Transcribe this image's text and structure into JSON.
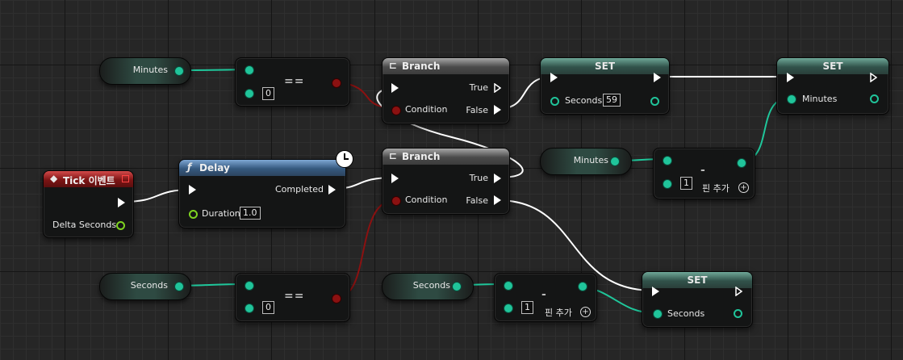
{
  "nodes": {
    "minutes_get_top": {
      "label": "Minutes"
    },
    "eq_top": {
      "op": "==",
      "input_value": "0"
    },
    "branch_top": {
      "title": "Branch",
      "true_label": "True",
      "false_label": "False",
      "condition_label": "Condition"
    },
    "set_seconds_59": {
      "title": "SET",
      "var_label": "Seconds",
      "value": "59"
    },
    "set_minutes": {
      "title": "SET",
      "var_label": "Minutes"
    },
    "tick_event": {
      "title": "Tick 이벤트",
      "output_label": "Delta Seconds"
    },
    "delay": {
      "title": "Delay",
      "completed_label": "Completed",
      "duration_label": "Duration",
      "duration_value": "1.0"
    },
    "branch_mid": {
      "title": "Branch",
      "true_label": "True",
      "false_label": "False",
      "condition_label": "Condition"
    },
    "minutes_get_mid": {
      "label": "Minutes"
    },
    "subtract_minutes": {
      "op": "-",
      "input_value": "1",
      "add_pin_label": "핀 추가"
    },
    "seconds_get_left": {
      "label": "Seconds"
    },
    "eq_bottom": {
      "op": "==",
      "input_value": "0"
    },
    "seconds_get_mid": {
      "label": "Seconds"
    },
    "subtract_seconds": {
      "op": "-",
      "input_value": "1",
      "add_pin_label": "핀 추가"
    },
    "set_seconds": {
      "title": "SET",
      "var_label": "Seconds"
    }
  },
  "colors": {
    "exec_wire": "#ffffff",
    "integer_wire": "#1fc79b",
    "bool_wire": "#8b1111",
    "function_header": "#35587e",
    "event_header": "#7c1414"
  }
}
